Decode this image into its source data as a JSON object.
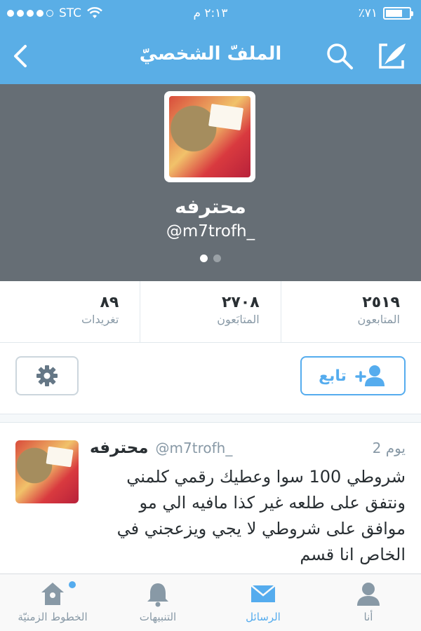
{
  "status_bar": {
    "carrier": "STC",
    "time": "٢:١٣ م",
    "battery_text": "٪٧١",
    "battery_level": 0.71,
    "signal_bars": 4
  },
  "nav": {
    "title": "الملفّ الشخصيّ",
    "icons": {
      "back": "chevron-left-icon",
      "search": "search-icon",
      "compose": "compose-icon"
    }
  },
  "profile": {
    "name": "محترفه",
    "handle": "@m7trofh_",
    "pager_count": 2,
    "pager_active": 0
  },
  "stats": [
    {
      "value": "٨٩",
      "label": "تغريدات"
    },
    {
      "value": "٢٧٠٨",
      "label": "المتابَعون"
    },
    {
      "value": "٢٥١٩",
      "label": "المتابعون"
    }
  ],
  "actions": {
    "follow_label": "تابع",
    "settings_icon": "gear-icon",
    "follow_icon": "add-user-icon"
  },
  "tweet": {
    "name": "محترفه",
    "handle": "@m7trofh_",
    "time": "2 يوم",
    "text": "شروطي 100 سوا وعطيك رقمي كلمني ونتفق على طلعه غير كذا مافيه الي مو موافق على شروطي لا يجي ويزعجني في الخاص انا قسم"
  },
  "tabs": [
    {
      "label": "الخطوط الزمنيّة",
      "icon": "home-icon",
      "active": false,
      "badge": true
    },
    {
      "label": "التنبيهات",
      "icon": "bell-icon",
      "active": false,
      "badge": false
    },
    {
      "label": "الرسائل",
      "icon": "envelope-icon",
      "active": true,
      "badge": false
    },
    {
      "label": "أنا",
      "icon": "user-icon",
      "active": false,
      "badge": false
    }
  ],
  "colors": {
    "brand": "#5aaee6",
    "accent": "#55acee",
    "header_bg": "#666e75",
    "muted": "#8899a6"
  }
}
